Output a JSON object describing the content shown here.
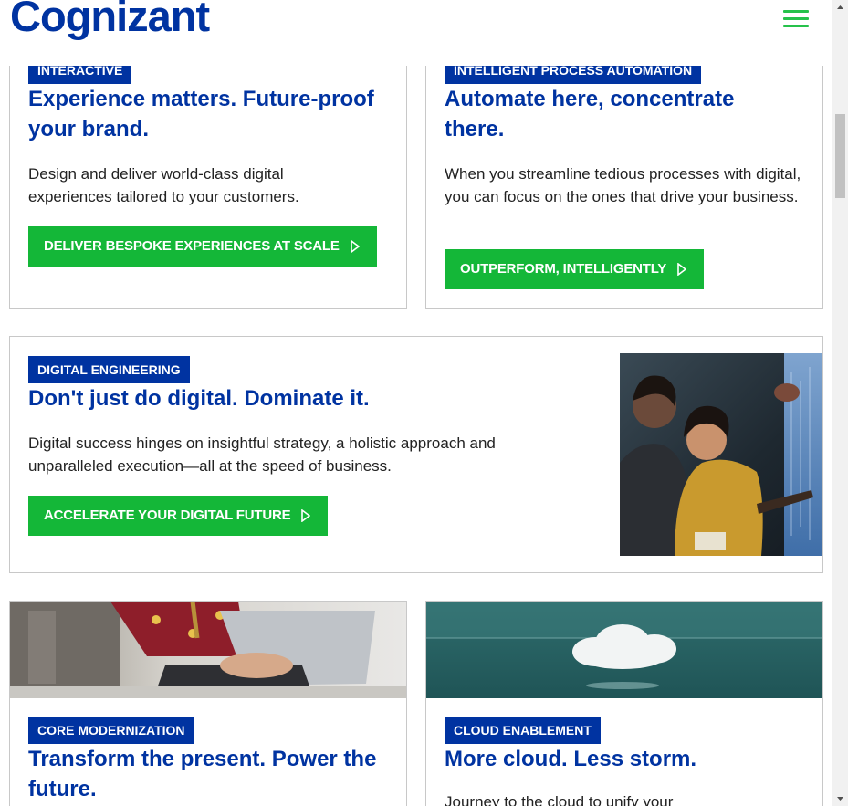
{
  "header": {
    "logo": "Cognizant",
    "menu_icon": "hamburger-menu-icon"
  },
  "cards": {
    "interactive": {
      "tag": "INTERACTIVE",
      "title": "Experience matters. Future-proof your brand.",
      "description": "Design and deliver world-class digital experiences tailored to your customers.",
      "cta": "DELIVER BESPOKE EXPERIENCES AT SCALE"
    },
    "automation": {
      "tag": "INTELLIGENT PROCESS AUTOMATION",
      "title": "Automate here, concentrate there.",
      "description": "When you streamline tedious processes with digital, you can focus on the ones that drive your business.",
      "cta": "OUTPERFORM, INTELLIGENTLY"
    },
    "engineering": {
      "tag": "DIGITAL ENGINEERING",
      "title": "Don't just do digital. Dominate it.",
      "description": "Digital success hinges on insightful strategy, a holistic approach and unparalleled execution—all at the speed of business.",
      "cta": "ACCELERATE YOUR DIGITAL FUTURE"
    },
    "modernization": {
      "tag": "CORE MODERNIZATION",
      "title": "Transform the present. Power the future."
    },
    "cloud": {
      "tag": "CLOUD ENABLEMENT",
      "title": "More cloud. Less storm.",
      "description": "Journey to the cloud to unify your"
    }
  },
  "colors": {
    "brand_blue": "#0033a1",
    "cta_green": "#14b738",
    "menu_green": "#26c24b"
  }
}
